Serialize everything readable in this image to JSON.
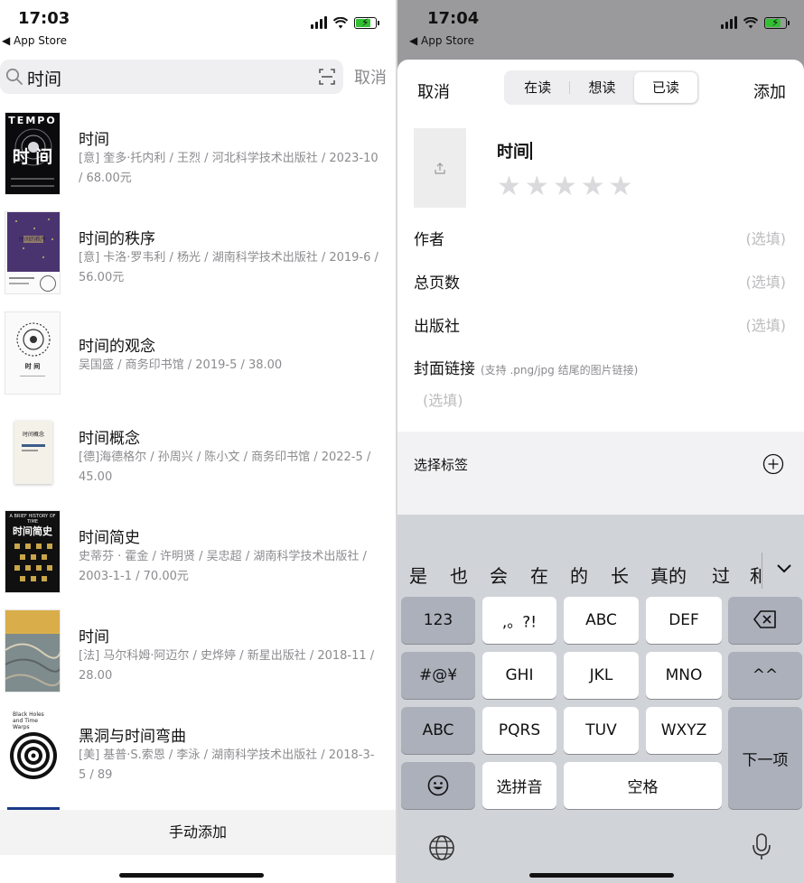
{
  "left": {
    "status": {
      "time": "17:03",
      "back": "◀ App Store"
    },
    "search": {
      "query": "时间",
      "cancel": "取消"
    },
    "books": [
      {
        "title": "时间",
        "meta": "[意] 奎多·托内利 / 王烈 / 河北科学技术出版社 / 2023-10 / 68.00元"
      },
      {
        "title": "时间的秩序",
        "meta": "[意] 卡洛·罗韦利 / 杨光 / 湖南科学技术出版社 / 2019-6 / 56.00元"
      },
      {
        "title": "时间的观念",
        "meta": "吴国盛 / 商务印书馆 / 2019-5 / 38.00"
      },
      {
        "title": "时间概念",
        "meta": "[德]海德格尔 / 孙周兴 / 陈小文 / 商务印书馆 / 2022-5 / 45.00"
      },
      {
        "title": "时间简史",
        "meta": "史蒂芬 · 霍金 / 许明贤 / 吴忠超 / 湖南科学技术出版社 / 2003-1-1 / 70.00元"
      },
      {
        "title": "时间",
        "meta": "[法] 马尔科姆·阿迈尔 / 史烨婷 / 新星出版社 / 2018-11 / 28.00"
      },
      {
        "title": "黑洞与时间弯曲",
        "meta": "[美] 基普·S.索恩 / 李泳 / 湖南科学技术出版社 / 2018-3-5 / 89"
      }
    ],
    "covers": {
      "tempo_top": "TEMPO",
      "tempo_title": "时 间",
      "order_title": "时间的秩序",
      "idea_title": "时 间",
      "concept_title": "时间概念",
      "brief_top": "A BRIEF HISTORY OF TIME",
      "brief_title": "时间简史",
      "blackhole_en": "Black Holes and Time Warps"
    },
    "manual_add": "手动添加"
  },
  "right": {
    "status": {
      "time": "17:04",
      "back": "◀ App Store"
    },
    "nav": {
      "cancel": "取消",
      "add": "添加"
    },
    "segments": [
      "在读",
      "想读",
      "已读"
    ],
    "active_segment": "已读",
    "title_input": "时间",
    "rating": {
      "stars": 0,
      "max": 5
    },
    "fields": [
      {
        "label": "作者",
        "placeholder": "(选填)"
      },
      {
        "label": "总页数",
        "placeholder": "(选填)"
      },
      {
        "label": "出版社",
        "placeholder": "(选填)"
      }
    ],
    "cover_link": {
      "label": "封面链接",
      "hint": "(支持 .png/jpg 结尾的图片链接)",
      "placeholder": "(选填)"
    },
    "tags_label": "选择标签",
    "keyboard": {
      "candidates": [
        "是",
        "也",
        "会",
        "在",
        "的",
        "长",
        "真的",
        "过",
        "和"
      ],
      "rows": [
        [
          "123",
          ",。?!",
          "ABC",
          "DEF"
        ],
        [
          "#@¥",
          "GHI",
          "JKL",
          "MNO",
          "^^"
        ],
        [
          "ABC",
          "PQRS",
          "TUV",
          "WXYZ"
        ],
        [
          "选拼音",
          "空格"
        ]
      ],
      "next": "下一项"
    }
  }
}
